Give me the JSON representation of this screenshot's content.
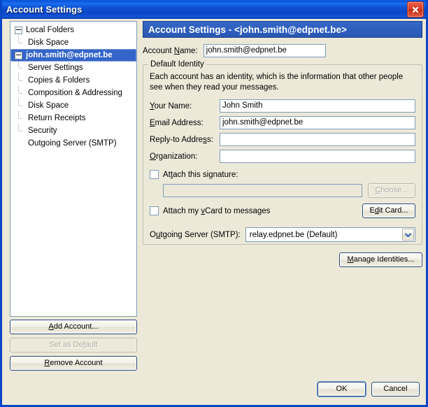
{
  "window": {
    "title": "Account Settings",
    "close_icon": "close-icon",
    "accent_titlebar": "#0a4fd0",
    "background": "#ece9d8"
  },
  "tree": {
    "items": [
      {
        "label": "Local Folders",
        "level": 0,
        "expander": "minus",
        "selected": false
      },
      {
        "label": "Disk Space",
        "level": 1,
        "expander": "none",
        "selected": false
      },
      {
        "label": "john.smith@edpnet.be",
        "level": 0,
        "expander": "minus",
        "selected": true
      },
      {
        "label": "Server Settings",
        "level": 1,
        "expander": "none",
        "selected": false
      },
      {
        "label": "Copies & Folders",
        "level": 1,
        "expander": "none",
        "selected": false
      },
      {
        "label": "Composition & Addressing",
        "level": 1,
        "expander": "none",
        "selected": false
      },
      {
        "label": "Disk Space",
        "level": 1,
        "expander": "none",
        "selected": false
      },
      {
        "label": "Return Receipts",
        "level": 1,
        "expander": "none",
        "selected": false
      },
      {
        "label": "Security",
        "level": 1,
        "expander": "none",
        "selected": false
      },
      {
        "label": "Outgoing Server (SMTP)",
        "level": 0,
        "expander": "none",
        "selected": false
      }
    ],
    "selection_color": "#3465c8"
  },
  "left_buttons": {
    "add_account": "Add Account...",
    "set_as_default": "Set as Default",
    "remove_account": "Remove Account"
  },
  "pane": {
    "header": "Account Settings - <john.smith@edpnet.be>",
    "account_name_label": "Account Name:",
    "account_name_value": "john.smith@edpnet.be"
  },
  "identity": {
    "group_title": "Default Identity",
    "description": "Each account has an identity, which is the information that other people see when they read your messages.",
    "fields": [
      {
        "label": "Your Name:",
        "value": "John Smith",
        "placeholder": ""
      },
      {
        "label": "Email Address:",
        "value": "john.smith@edpnet.be",
        "placeholder": ""
      },
      {
        "label": "Reply-to Address:",
        "value": "",
        "placeholder": ""
      },
      {
        "label": "Organization:",
        "value": "",
        "placeholder": ""
      }
    ],
    "attach_signature_label": "Attach this signature:",
    "attach_signature_checked": false,
    "signature_path_value": "",
    "choose_button": "Choose...",
    "choose_button_enabled": false,
    "attach_vcard_label": "Attach my vCard to messages",
    "attach_vcard_checked": false,
    "edit_card_button": "Edit Card...",
    "smtp_label": "Outgoing Server (SMTP):",
    "smtp_value": "relay.edpnet.be (Default)",
    "smtp_options": [
      "relay.edpnet.be (Default)"
    ],
    "manage_identities_button": "Manage Identities..."
  },
  "dialog_buttons": {
    "ok": "OK",
    "cancel": "Cancel"
  }
}
